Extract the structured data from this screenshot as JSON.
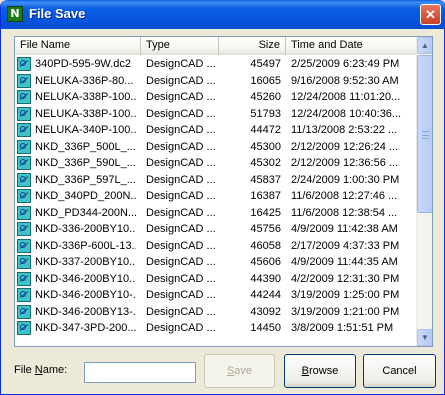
{
  "window": {
    "title": "File Save",
    "icon_letter": "N",
    "close_glyph": "✕"
  },
  "list": {
    "columns": {
      "name": "File Name",
      "type": "Type",
      "size": "Size",
      "date": "Time and Date"
    },
    "rows": [
      {
        "name": "340PD-595-9W.dc2",
        "type": "DesignCAD ...",
        "size": "45497",
        "date": "2/25/2009 6:23:49 PM"
      },
      {
        "name": "NELUKA-336P-80...",
        "type": "DesignCAD ...",
        "size": "16065",
        "date": "9/16/2008 9:52:30 AM"
      },
      {
        "name": "NELUKA-338P-100...",
        "type": "DesignCAD ...",
        "size": "45260",
        "date": "12/24/2008 11:01:20..."
      },
      {
        "name": "NELUKA-338P-100...",
        "type": "DesignCAD ...",
        "size": "51793",
        "date": "12/24/2008 10:40:36..."
      },
      {
        "name": "NELUKA-340P-100...",
        "type": "DesignCAD ...",
        "size": "44472",
        "date": "11/13/2008 2:53:22 ..."
      },
      {
        "name": "NKD_336P_500L_...",
        "type": "DesignCAD ...",
        "size": "45300",
        "date": "2/12/2009 12:26:24 ..."
      },
      {
        "name": "NKD_336P_590L_...",
        "type": "DesignCAD ...",
        "size": "45302",
        "date": "2/12/2009 12:36:56 ..."
      },
      {
        "name": "NKD_336P_597L_...",
        "type": "DesignCAD ...",
        "size": "45837",
        "date": "2/24/2009 1:00:30 PM"
      },
      {
        "name": "NKD_340PD_200N...",
        "type": "DesignCAD ...",
        "size": "16387",
        "date": "11/6/2008 12:27:46 ..."
      },
      {
        "name": "NKD_PD344-200N...",
        "type": "DesignCAD ...",
        "size": "16425",
        "date": "11/6/2008 12:38:54 ..."
      },
      {
        "name": "NKD-336-200BY10...",
        "type": "DesignCAD ...",
        "size": "45756",
        "date": "4/9/2009 11:42:38 AM"
      },
      {
        "name": "NKD-336P-600L-13...",
        "type": "DesignCAD ...",
        "size": "46058",
        "date": "2/17/2009 4:37:33 PM"
      },
      {
        "name": "NKD-337-200BY10...",
        "type": "DesignCAD ...",
        "size": "45606",
        "date": "4/9/2009 11:44:35 AM"
      },
      {
        "name": "NKD-346-200BY10...",
        "type": "DesignCAD ...",
        "size": "44390",
        "date": "4/2/2009 12:31:30 PM"
      },
      {
        "name": "NKD-346-200BY10-...",
        "type": "DesignCAD ...",
        "size": "44244",
        "date": "3/19/2009 1:25:00 PM"
      },
      {
        "name": "NKD-346-200BY13-...",
        "type": "DesignCAD ...",
        "size": "43092",
        "date": "3/19/2009 1:21:00 PM"
      },
      {
        "name": "NKD-347-3PD-200...",
        "type": "DesignCAD ...",
        "size": "14450",
        "date": "3/8/2009 1:51:51 PM"
      }
    ]
  },
  "form": {
    "filename_label_prefix": "File ",
    "filename_label_underlined": "N",
    "filename_label_suffix": "ame:",
    "filename_value": "",
    "save_underlined": "S",
    "save_rest": "ave",
    "save_enabled": false,
    "browse_prefix": "",
    "browse_underlined": "B",
    "browse_rest": "rowse",
    "cancel_label": "Cancel"
  },
  "scrollbar": {
    "up_glyph": "▲",
    "down_glyph": "▼"
  },
  "colors": {
    "titlebar": "#0453dc",
    "list_border": "#7f9db9",
    "file_icon": "#3fc2c8"
  }
}
